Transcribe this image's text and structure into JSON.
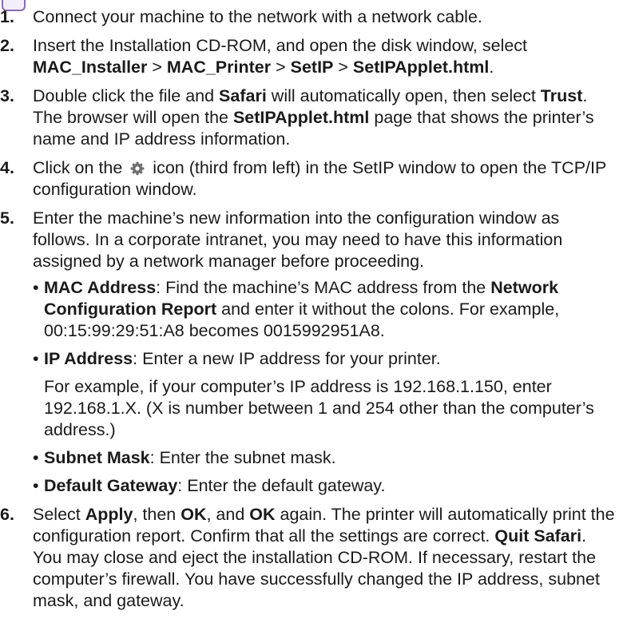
{
  "steps": [
    {
      "num": "1.",
      "text": "Connect your machine to the network with a network cable."
    },
    {
      "num": "2.",
      "t1": "Insert the Installation CD-ROM, and open the disk window, select ",
      "b1": "MAC_Installer",
      "s1": " > ",
      "b2": "MAC_Printer",
      "s2": " > ",
      "b3": "SetIP",
      "s3": " > ",
      "b4": "SetIPApplet.html",
      "t2": "."
    },
    {
      "num": "3.",
      "t1": "Double click the file and ",
      "b1": "Safari",
      "t2": " will automatically open, then select ",
      "b2": "Trust",
      "t3": ". The browser will open the ",
      "b3": "SetIPApplet.html",
      "t4": " page that shows the printer’s name and IP address information."
    },
    {
      "num": "4.",
      "t1": "Click on the ",
      "icon": "gear-icon",
      "t2": " icon (third from left) in the SetIP window to open the TCP/IP configuration window."
    },
    {
      "num": "5.",
      "text": "Enter the machine’s new information into the configuration window as follows. In a corporate intranet, you may need to have this information assigned by a network manager before proceeding.",
      "subs": [
        {
          "bullet": "•",
          "label": "MAC Address",
          "t1": ": Find the machine’s MAC address from the ",
          "b1": "Network Configuration Report",
          "t2": " and enter it without the colons. For example, 00:15:99:29:51:A8 becomes 0015992951A8."
        },
        {
          "bullet": "•",
          "label": "IP Address",
          "t1": ": Enter a new IP address for your printer.",
          "note": "For example, if your computer’s IP address is 192.168.1.150, enter 192.168.1.X. (X is number between 1 and 254 other than the computer’s address.)"
        },
        {
          "bullet": "•",
          "label": "Subnet Mask",
          "t1": ": Enter the subnet mask."
        },
        {
          "bullet": "•",
          "label": "Default Gateway",
          "t1": ": Enter the default gateway."
        }
      ]
    },
    {
      "num": "6.",
      "t1": "Select ",
      "b1": "Apply",
      "t2": ", then ",
      "b2": "OK",
      "t3": ", and ",
      "b3": "OK",
      "t4": " again. The printer will automatically print the configuration report. Confirm that all the settings are correct. ",
      "b4": "Quit Safari",
      "t5": ". You may close and eject the installation CD-ROM. If necessary, restart the computer’s firewall. You have successfully changed the IP address, subnet mask, and gateway."
    }
  ]
}
